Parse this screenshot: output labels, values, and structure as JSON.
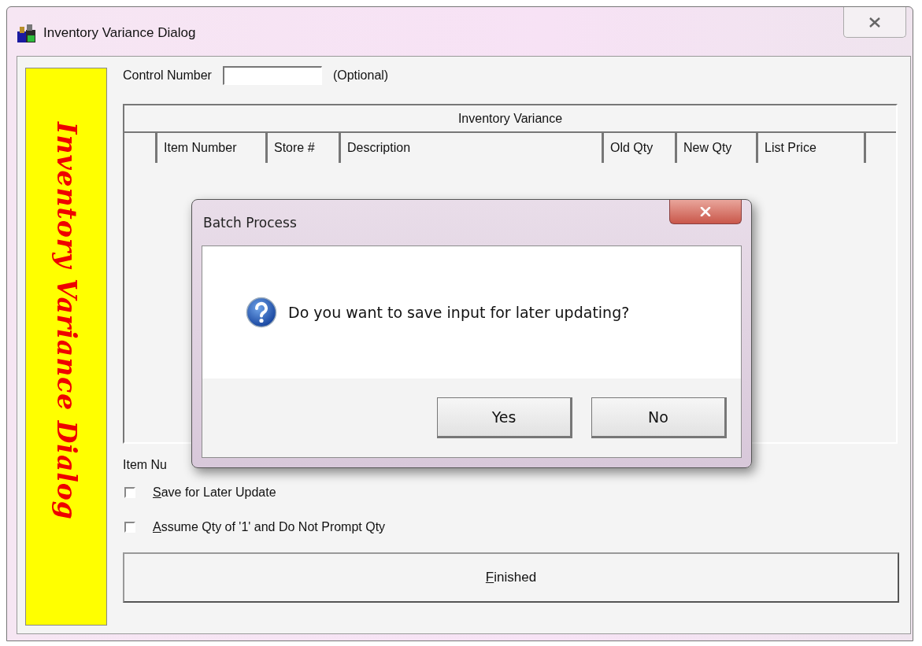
{
  "window": {
    "title": "Inventory Variance Dialog"
  },
  "side_banner": {
    "text": "Inventory Variance Dialog"
  },
  "control_number": {
    "label": "Control Number",
    "hint": "(Optional)"
  },
  "grid": {
    "title": "Inventory Variance",
    "columns": [
      "Item Number",
      "Store #",
      "Description",
      "Old Qty",
      "New Qty",
      "List Price"
    ]
  },
  "item_entry": {
    "label": "Item Nu"
  },
  "options": [
    {
      "label": "Save for Later Update",
      "checked": false,
      "underline_first_letter": true
    },
    {
      "label": "Assume Qty of '1' and Do Not Prompt Qty",
      "checked": false,
      "underline_first_letter": true
    }
  ],
  "finish_button": {
    "label": "Finished",
    "underline_first_letter": true
  },
  "message_box": {
    "title": "Batch Process",
    "message": "Do you want to save input for later updating?",
    "buttons": [
      "Yes",
      "No"
    ]
  }
}
